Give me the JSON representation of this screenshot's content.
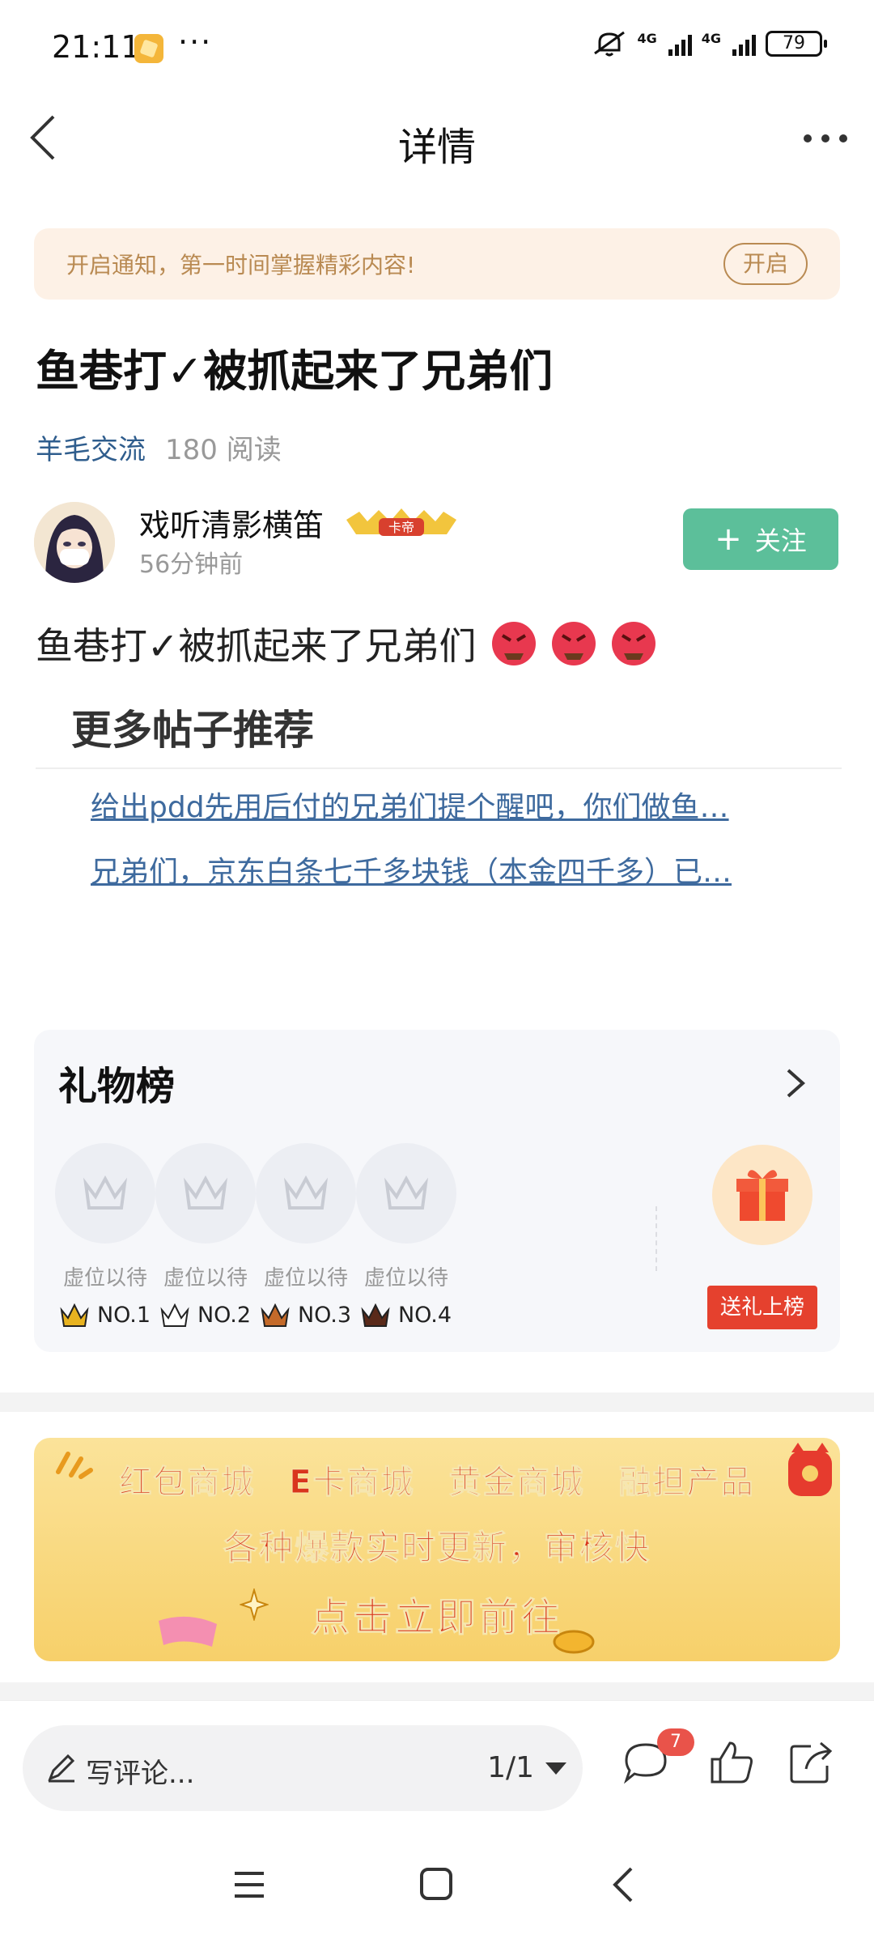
{
  "status_bar": {
    "time": "21:11",
    "dots": "···",
    "net1": "4G",
    "net2": "4G",
    "battery": "79"
  },
  "header": {
    "title": "详情"
  },
  "notify": {
    "text": "开启通知，第一时间掌握精彩内容!",
    "button": "开启"
  },
  "post": {
    "title": "鱼巷打✓被抓起来了兄弟们",
    "category": "羊毛交流",
    "reads": "180 阅读",
    "author": "戏听清影横笛",
    "author_badge": "卡帝",
    "time": "56分钟前",
    "follow": "关注",
    "follow_icon": "+",
    "content": "鱼巷打✓被抓起来了兄弟们"
  },
  "recommend": {
    "title": "更多帖子推荐",
    "links": [
      "给出pdd先用后付的兄弟们提个醒吧，你们做鱼…",
      "兄弟们，京东白条七千多块钱（本金四千多）已…"
    ]
  },
  "gift_board": {
    "title": "礼物榜",
    "slots": [
      {
        "label": "虚位以待",
        "rank": "NO.1",
        "crown_color": "#e8b320"
      },
      {
        "label": "虚位以待",
        "rank": "NO.2",
        "crown_color": "#3a3a3a"
      },
      {
        "label": "虚位以待",
        "rank": "NO.3",
        "crown_color": "#c46a2a"
      },
      {
        "label": "虚位以待",
        "rank": "NO.4",
        "crown_color": "#5a2a1a"
      }
    ],
    "send_button": "送礼上榜"
  },
  "promo": {
    "line1": "红包商城　E卡商城　黄金商城　融担产品",
    "line2": "各种爆款实时更新，审核快",
    "line3": "点击立即前往"
  },
  "bottom_bar": {
    "comment_placeholder": "写评论...",
    "page_indicator": "1/1",
    "comment_count": "7"
  },
  "colors": {
    "accent_green": "#5cbf9a",
    "link_blue": "#3e6a9e",
    "red": "#e5412e"
  }
}
